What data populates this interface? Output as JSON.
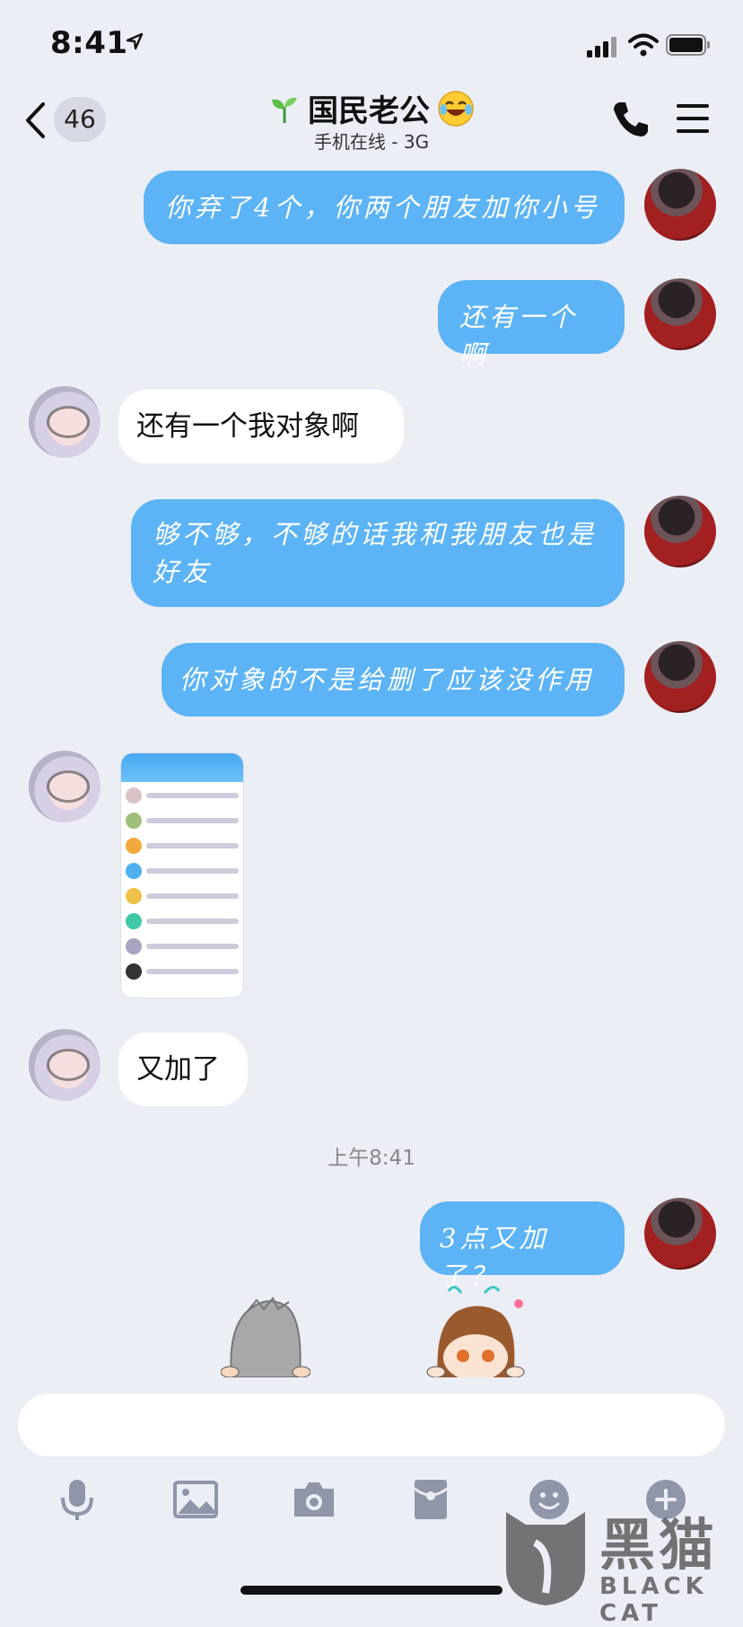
{
  "status": {
    "time": "8:41"
  },
  "header": {
    "back_count": "46",
    "title": "国民老公",
    "subtitle": "手机在线 - 3G"
  },
  "messages": [
    {
      "side": "out",
      "text": "你弃了4个，你两个朋友加你小号"
    },
    {
      "side": "out",
      "text": "还有一个啊"
    },
    {
      "side": "in",
      "text": "还有一个我对象啊"
    },
    {
      "side": "out",
      "text": "够不够，不够的话我和我朋友也是好友"
    },
    {
      "side": "out",
      "text": "你对象的不是给删了应该没作用"
    },
    {
      "side": "in",
      "type": "image"
    },
    {
      "side": "in",
      "text": "又加了"
    },
    {
      "side": "out",
      "text": "3点又加了？"
    }
  ],
  "time_divider": "上午8:41",
  "input": {
    "placeholder": ""
  },
  "watermark": {
    "cn": "黑猫",
    "en": "BLACK CAT"
  },
  "colors": {
    "accent": "#5cb3f5",
    "background": "#eceef6"
  }
}
